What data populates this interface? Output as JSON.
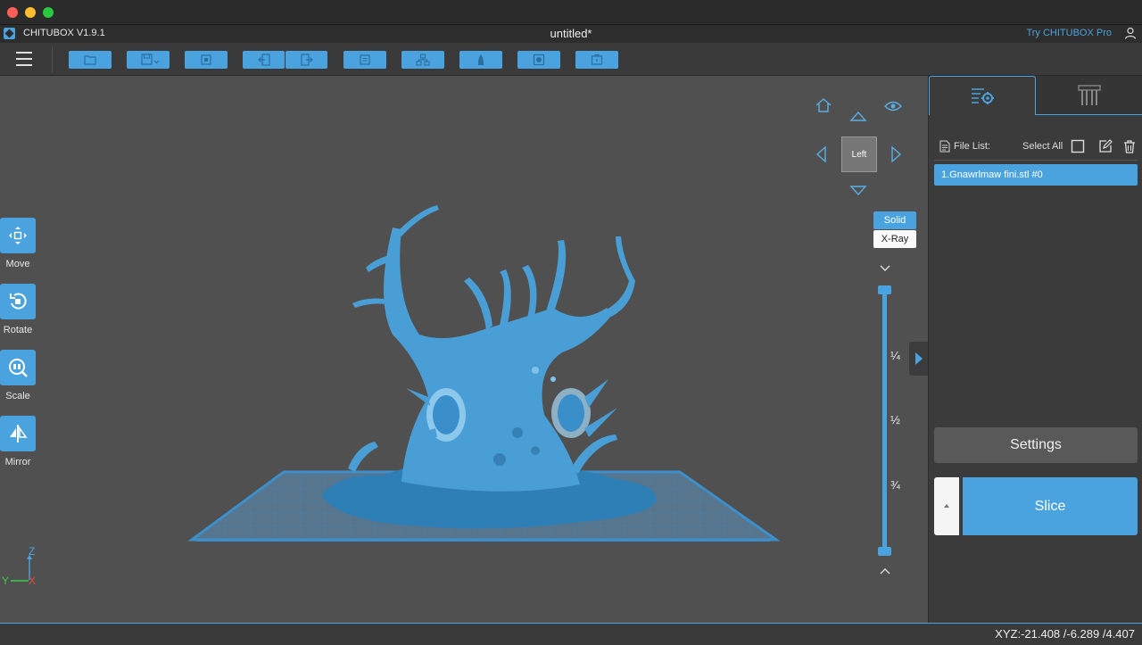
{
  "app": {
    "name": "CHITUBOX V1.9.1",
    "document_title": "untitled*",
    "try_pro_label": "Try CHITUBOX Pro"
  },
  "toolbar": {
    "buttons": [
      "open-file-icon",
      "save-icon",
      "auto-layout-icon",
      "undo-icon",
      "redo-icon",
      "copy-icon",
      "model-icon",
      "support-icon",
      "hollow-icon",
      "dig-hole-icon"
    ]
  },
  "left_tools": [
    {
      "label": "Move",
      "icon": "move-icon"
    },
    {
      "label": "Rotate",
      "icon": "rotate-icon"
    },
    {
      "label": "Scale",
      "icon": "scale-icon"
    },
    {
      "label": "Mirror",
      "icon": "mirror-icon"
    }
  ],
  "view": {
    "cube_label": "Left",
    "modes": {
      "solid": "Solid",
      "xray": "X-Ray"
    },
    "slider_marks": [
      "¼",
      "½",
      "¾"
    ],
    "axes": {
      "x": "X",
      "y": "Y",
      "z": "Z"
    }
  },
  "right_panel": {
    "file_list_label": "File List:",
    "select_all_label": "Select All",
    "files": [
      "1.Gnawrlmaw fini.stl #0"
    ],
    "settings_label": "Settings",
    "slice_label": "Slice"
  },
  "status": {
    "coords": "XYZ:-21.408 /-6.289 /4.407"
  },
  "colors": {
    "accent": "#4aa3df",
    "viewport": "#505050",
    "panel": "#3b3b3b"
  }
}
